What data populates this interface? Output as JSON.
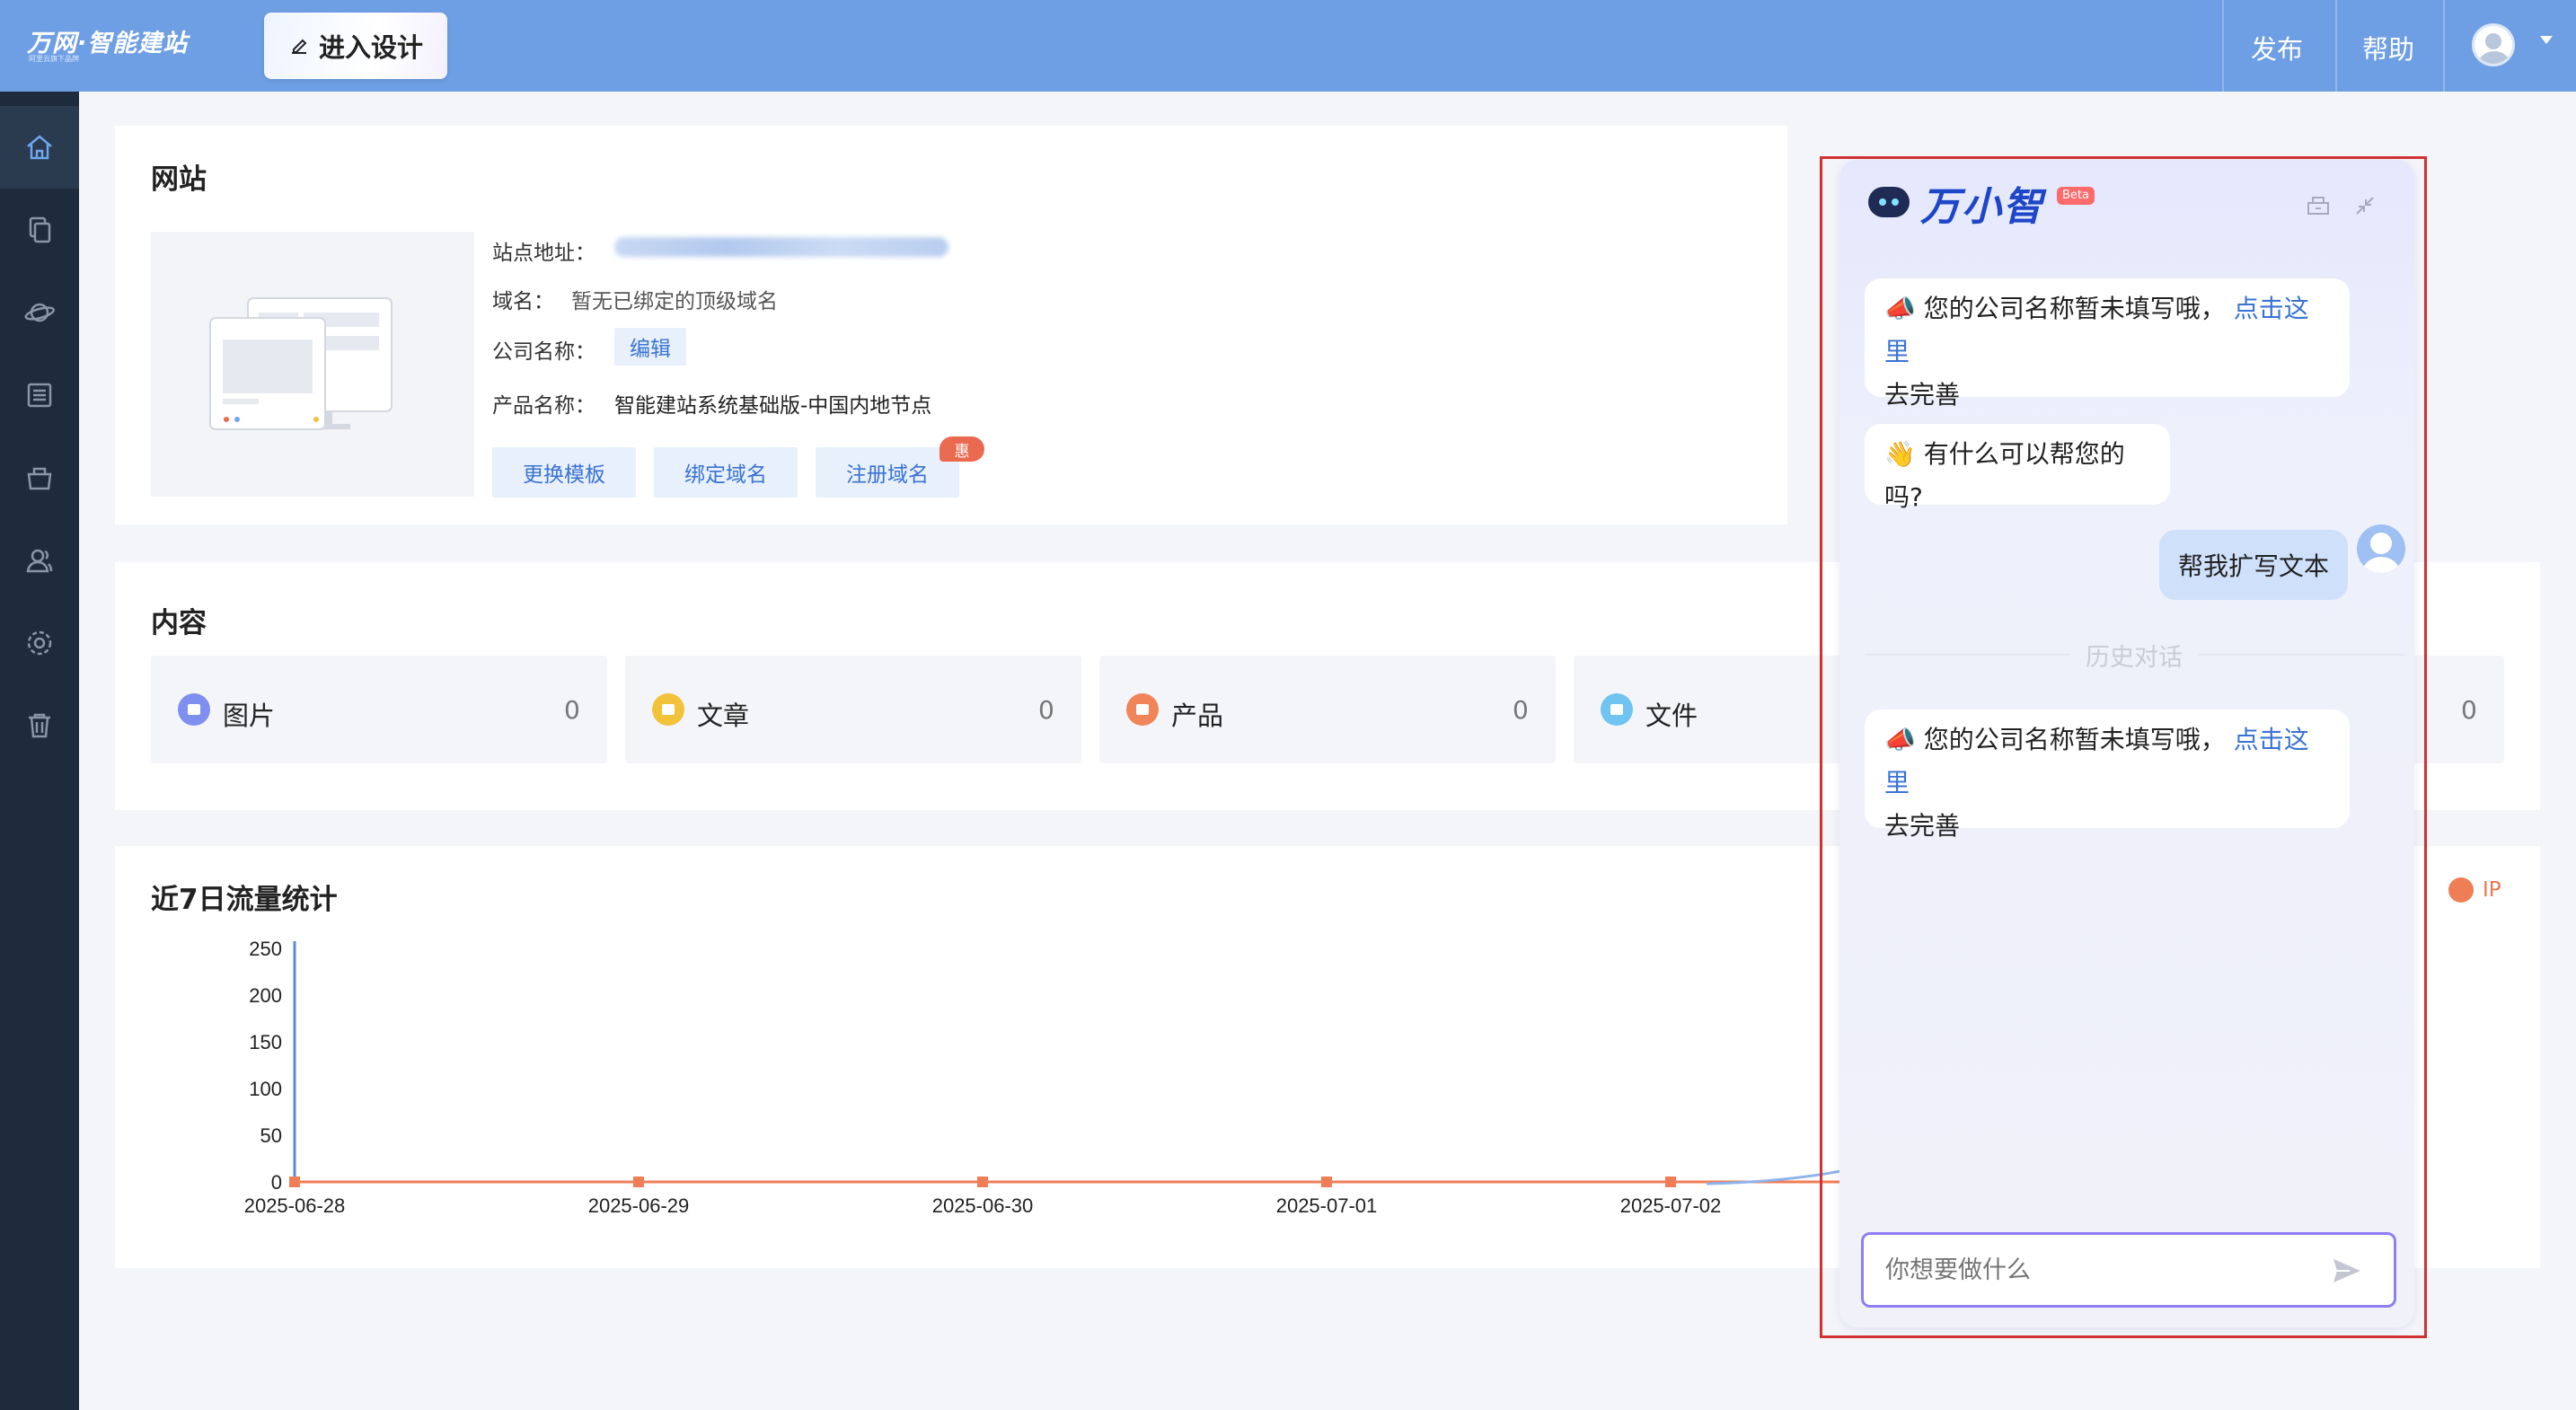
{
  "topbar": {
    "logo": "万网·智能建站",
    "logo_sub": "阿里云旗下品牌",
    "design_button": "进入设计",
    "publish": "发布",
    "help": "帮助"
  },
  "sidebar": {
    "items": [
      {
        "name": "home",
        "icon": "home-icon"
      },
      {
        "name": "pages",
        "icon": "pages-icon"
      },
      {
        "name": "planet",
        "icon": "planet-icon"
      },
      {
        "name": "list",
        "icon": "list-icon"
      },
      {
        "name": "shop",
        "icon": "shop-icon"
      },
      {
        "name": "users",
        "icon": "users-icon"
      },
      {
        "name": "settings",
        "icon": "gear-icon"
      },
      {
        "name": "trash",
        "icon": "trash-icon"
      }
    ]
  },
  "website": {
    "title": "网站",
    "site_address_label": "站点地址：",
    "domain_label": "域名：",
    "domain_value": "暂无已绑定的顶级域名",
    "company_label": "公司名称：",
    "company_edit": "编辑",
    "product_label": "产品名称：",
    "product_value": "智能建站系统基础版-中国内地节点",
    "buttons": {
      "change_template": "更换模板",
      "bind_domain": "绑定域名",
      "register_domain": "注册域名"
    },
    "badge": "惠"
  },
  "content": {
    "title": "内容",
    "stats": [
      {
        "label": "图片",
        "count": "0",
        "color": "#7e8ff0"
      },
      {
        "label": "文章",
        "count": "0",
        "color": "#f2c23a"
      },
      {
        "label": "产品",
        "count": "0",
        "color": "#f0855a"
      },
      {
        "label": "文件",
        "count": "",
        "color": "#6fc4f2"
      },
      {
        "label": "",
        "count": "0",
        "color": ""
      }
    ]
  },
  "traffic": {
    "title": "近7日流量统计",
    "legend": "IP"
  },
  "chart_data": {
    "type": "line",
    "x": [
      "2025-06-28",
      "2025-06-29",
      "2025-06-30",
      "2025-07-01",
      "2025-07-02"
    ],
    "ylim": [
      0,
      250
    ],
    "yticks": [
      0,
      50,
      100,
      150,
      200,
      250
    ],
    "series": [
      {
        "name": "IP",
        "values": [
          0,
          0,
          0,
          0,
          0
        ],
        "color": "#ef7e56"
      }
    ]
  },
  "chat": {
    "brand": "万小智",
    "beta": "Beta",
    "messages": [
      {
        "emoji": "📣",
        "text": "您的公司名称暂未填写哦，",
        "link": "点击这里",
        "tail": "去完善"
      },
      {
        "emoji": "👋",
        "text": "有什么可以帮您的吗?"
      }
    ],
    "user_message": "帮我扩写文本",
    "history_label": "历史对话",
    "history_message": {
      "emoji": "📣",
      "text": "您的公司名称暂未填写哦，",
      "link": "点击这里",
      "tail": "去完善"
    },
    "input_placeholder": "你想要做什么"
  }
}
